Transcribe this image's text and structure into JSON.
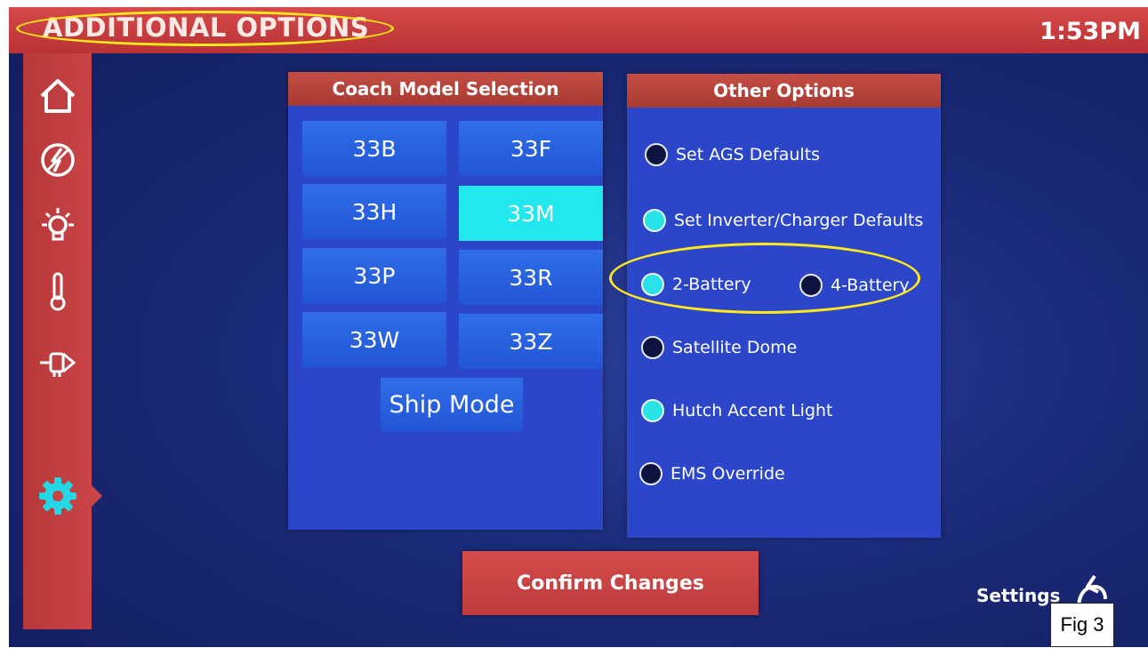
{
  "header": {
    "title": "ADDITIONAL OPTIONS",
    "time": "1:53PM"
  },
  "sidebar": {
    "items": [
      {
        "name": "home",
        "icon": "home-icon"
      },
      {
        "name": "power",
        "icon": "power-icon"
      },
      {
        "name": "lights",
        "icon": "lightbulb-icon"
      },
      {
        "name": "climate",
        "icon": "thermometer-icon"
      },
      {
        "name": "devices",
        "icon": "plug-icon"
      },
      {
        "name": "settings",
        "icon": "gear-icon",
        "active": true
      }
    ]
  },
  "coach_model": {
    "title": "Coach Model Selection",
    "models": [
      "33B",
      "33F",
      "33H",
      "33M",
      "33P",
      "33R",
      "33W",
      "33Z"
    ],
    "selected": "33M",
    "ship_mode_label": "Ship Mode"
  },
  "other_options": {
    "title": "Other Options",
    "items": [
      {
        "label": "Set AGS Defaults",
        "checked": false
      },
      {
        "label": "Set Inverter/Charger Defaults",
        "checked": true
      },
      {
        "label": "2-Battery",
        "checked": true
      },
      {
        "label": "4-Battery",
        "checked": false
      },
      {
        "label": "Satellite Dome",
        "checked": false
      },
      {
        "label": "Hutch Accent Light",
        "checked": true
      },
      {
        "label": "EMS Override",
        "checked": false
      }
    ]
  },
  "footer": {
    "confirm_label": "Confirm Changes",
    "settings_label": "Settings",
    "figure_label": "Fig 3"
  },
  "colors": {
    "accent_red": "#c23d3f",
    "selected_cyan": "#22e8ee",
    "button_blue": "#2860e0",
    "panel_blue": "#2c46c9",
    "highlight_yellow": "#ffe81c"
  }
}
